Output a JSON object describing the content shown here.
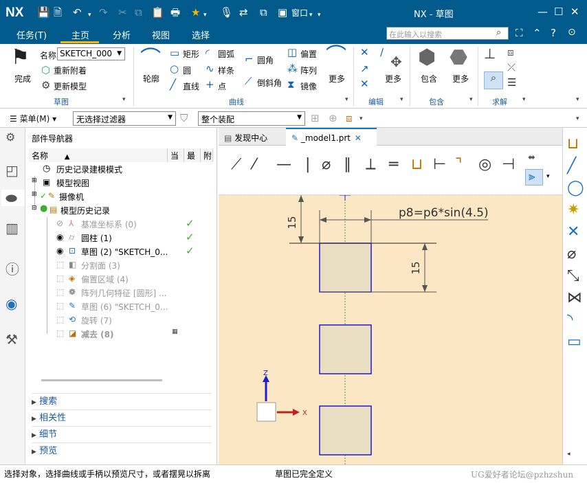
{
  "titlebar": {
    "logo": "NX",
    "window_menu": "窗口",
    "title": "NX - 草图",
    "minimize": "—",
    "restore": "☐",
    "close": "✕"
  },
  "menu": {
    "tabs": [
      "任务(T)",
      "主页",
      "分析",
      "视图",
      "选择"
    ],
    "search_placeholder": "在此输入以搜索"
  },
  "ribbon": {
    "finish": "完成",
    "name_label": "名称",
    "name_value": "SKETCH_000",
    "reattach": "重新附着",
    "update_model": "更新模型",
    "profile": "轮廓",
    "rectangle": "矩形",
    "arc": "圆弧",
    "fillet": "圆角",
    "offset": "偏置",
    "circle": "圆",
    "studio_spline": "样条",
    "chamfer": "倒斜角",
    "pattern": "阵列",
    "line": "直线",
    "point": "点",
    "mirror": "镜像",
    "more": "更多",
    "include": "包含",
    "groups": {
      "sketch": "草图",
      "curve": "曲线",
      "edit": "编辑",
      "include": "包含",
      "solve": "求解"
    }
  },
  "filterbar": {
    "menu": "菜单(M)",
    "filter": "无选择过滤器",
    "scope": "整个装配"
  },
  "navigator": {
    "title": "部件导航器",
    "columns": [
      "名称",
      "当",
      "最",
      "附"
    ],
    "rows": [
      {
        "label": "历史记录建模模式",
        "dim": false
      },
      {
        "label": "模型视图",
        "dim": false
      },
      {
        "label": "摄像机",
        "dim": false
      },
      {
        "label": "模型历史记录",
        "dim": false
      },
      {
        "label": "基准坐标系 (0)",
        "dim": true
      },
      {
        "label": "圆柱 (1)",
        "dim": false
      },
      {
        "label": "草图 (2) \"SKETCH_0...",
        "dim": false
      },
      {
        "label": "分割面 (3)",
        "dim": true
      },
      {
        "label": "偏置区域 (4)",
        "dim": true
      },
      {
        "label": "阵列几何特征 [圆形] ...",
        "dim": true
      },
      {
        "label": "草图 (6) \"SKETCH_0...",
        "dim": true
      },
      {
        "label": "旋转 (7)",
        "dim": true
      },
      {
        "label": "减去 (8)",
        "dim": true
      }
    ],
    "sections": [
      "搜索",
      "相关性",
      "细节",
      "预览"
    ]
  },
  "tabs": {
    "discover": "发现中心",
    "model": "_model1.prt",
    "close": "✕"
  },
  "canvas": {
    "dim_expression": "p8=p6*sin(4.5)",
    "dim_15_a": "15",
    "dim_15_b": "15",
    "axis_z": "Z",
    "axis_x": "X"
  },
  "status": {
    "prompt": "选择对象，选择曲线或手柄以预览尺寸，或者摆晃以拆离",
    "sketch_state": "草图已完全定义",
    "watermark": "UG爱好者论坛@pzhzshun"
  },
  "colors": {
    "title_bg": "#005a8c",
    "canvas_bg": "#fbe7c4",
    "accent": "#ffb400",
    "sketch_blue": "#1c1ccf"
  }
}
